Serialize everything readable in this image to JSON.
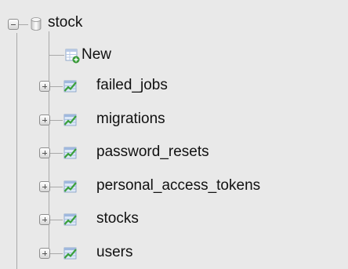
{
  "database": {
    "name": "stock",
    "icon": "database-icon",
    "expanded": true
  },
  "new_item": {
    "label": "New",
    "icon": "new-table-icon"
  },
  "tables": [
    {
      "name": "failed_jobs",
      "icon": "table-icon"
    },
    {
      "name": "migrations",
      "icon": "table-icon"
    },
    {
      "name": "password_resets",
      "icon": "table-icon"
    },
    {
      "name": "personal_access_tokens",
      "icon": "table-icon"
    },
    {
      "name": "stocks",
      "icon": "table-icon"
    },
    {
      "name": "users",
      "icon": "table-icon"
    }
  ]
}
